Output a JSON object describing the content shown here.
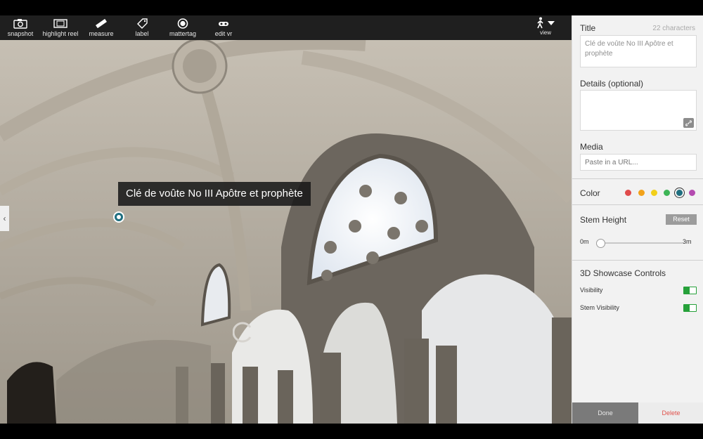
{
  "toolbar": {
    "tools": [
      {
        "label": "snapshot",
        "icon": "camera-icon"
      },
      {
        "label": "highlight reel",
        "icon": "film-icon"
      },
      {
        "label": "measure",
        "icon": "ruler-icon"
      },
      {
        "label": "label",
        "icon": "tag-icon"
      },
      {
        "label": "mattertag",
        "icon": "mattertag-icon"
      },
      {
        "label": "edit vr",
        "icon": "vr-goggles-icon"
      }
    ],
    "view_label": "view"
  },
  "viewport": {
    "tag_label": "Clé de voûte No III Apôtre et prophète"
  },
  "panel": {
    "title_heading": "Title",
    "char_count": "22 characters",
    "title_value": "Clé de voûte No III Apôtre et prophète",
    "details_heading": "Details (optional)",
    "details_value": "",
    "media_heading": "Media",
    "media_placeholder": "Paste in a URL...",
    "color_heading": "Color",
    "colors": [
      {
        "hex": "#e04b4b",
        "selected": false
      },
      {
        "hex": "#f2a21a",
        "selected": false
      },
      {
        "hex": "#f2cf1a",
        "selected": false
      },
      {
        "hex": "#3db556",
        "selected": false
      },
      {
        "hex": "#1f6f80",
        "selected": true
      },
      {
        "hex": "#b44bb0",
        "selected": false
      }
    ],
    "stem_heading": "Stem Height",
    "reset_label": "Reset",
    "range_min": "0m",
    "range_max": "3m",
    "stem_height_fraction": 0,
    "controls_heading": "3D Showcase Controls",
    "visibility_label": "Visibility",
    "visibility_on": true,
    "stem_visibility_label": "Stem Visibility",
    "stem_visibility_on": true,
    "done_label": "Done",
    "delete_label": "Delete"
  }
}
